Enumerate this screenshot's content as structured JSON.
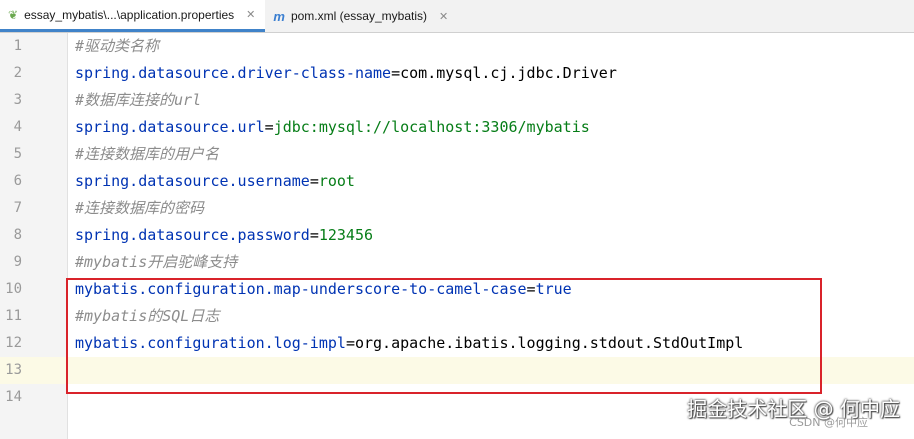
{
  "tabs": [
    {
      "label": "essay_mybatis\\...\\application.properties",
      "icon": "spring-leaf-icon",
      "active": true
    },
    {
      "label": "pom.xml (essay_mybatis)",
      "icon": "maven-m-icon",
      "active": false
    }
  ],
  "close_glyph": "✕",
  "editor": {
    "lines": [
      {
        "num": "1",
        "comment": "#驱动类名称"
      },
      {
        "num": "2",
        "key": "spring.datasource.driver-class-name",
        "eq": "=",
        "value": "com.mysql.cj.jdbc.Driver"
      },
      {
        "num": "3",
        "comment": "#数据库连接的url"
      },
      {
        "num": "4",
        "key": "spring.datasource.url",
        "eq": "=",
        "value": "jdbc:mysql://localhost:3306/mybatis"
      },
      {
        "num": "5",
        "comment": "#连接数据库的用户名"
      },
      {
        "num": "6",
        "key": "spring.datasource.username",
        "eq": "=",
        "value": "root"
      },
      {
        "num": "7",
        "comment": "#连接数据库的密码"
      },
      {
        "num": "8",
        "key": "spring.datasource.password",
        "eq": "=",
        "value": "123456"
      },
      {
        "num": "9",
        "comment": "#mybatis开启驼峰支持"
      },
      {
        "num": "10",
        "key": "mybatis.configuration.map-underscore-to-camel-case",
        "eq": "=",
        "value": "true"
      },
      {
        "num": "11",
        "comment": "#mybatis的SQL日志"
      },
      {
        "num": "12",
        "key": "mybatis.configuration.log-impl",
        "eq": "=",
        "value": "org.apache.ibatis.logging.stdout.StdOutImpl"
      },
      {
        "num": "13"
      },
      {
        "num": "14"
      }
    ]
  },
  "watermark": {
    "main": "掘金技术社区 @ 何中应",
    "small": "CSDN @何中应"
  },
  "colors": {
    "highlight_border": "#d9232a",
    "tab_accent": "#4083c9"
  }
}
